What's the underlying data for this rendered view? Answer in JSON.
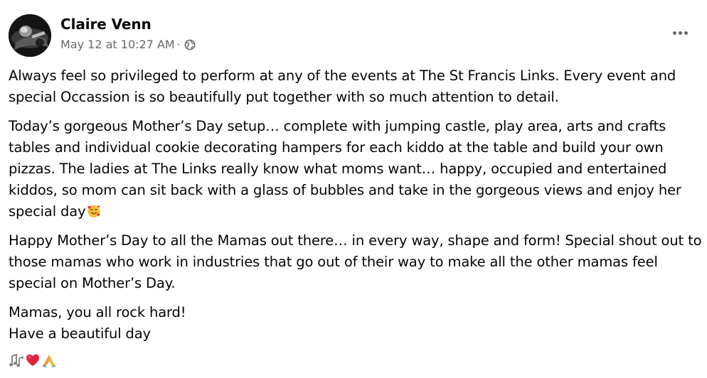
{
  "post": {
    "author": "Claire Venn",
    "timestamp": "May 12 at 10:27 AM",
    "separator": "·",
    "audience_icon": "globe-icon",
    "more_icon": "more-options-icon",
    "paragraphs": [
      "Always feel so privileged to perform at any of the events at The St Francis Links. Every event and special Occassion is so beautifully put together with so much attention to detail.",
      "Today’s gorgeous Mother’s Day setup… complete with jumping castle, play area, arts and crafts tables and individual cookie decorating hampers for each kiddo at the table and build your own pizzas. The ladies at The Links really know what moms want… happy, occupied and entertained kiddos, so mom can sit back with a glass of bubbles and take in the gorgeous views and enjoy her special day",
      "Happy Mother’s Day to all the Mamas out there… in every way, shape and form! Special shout out to those mamas who work in industries that go out of their way to make all the other mamas feel special on Mother’s Day.",
      "Mamas, you all rock hard!\nHave a beautiful day"
    ],
    "inline_emoji": "smiling-face-with-hearts-icon",
    "trailing_emojis": [
      "musical-notes-icon",
      "red-heart-icon",
      "folded-hands-icon"
    ]
  },
  "colors": {
    "text": "#050505",
    "secondary_text": "#65676b",
    "background": "#ffffff"
  }
}
